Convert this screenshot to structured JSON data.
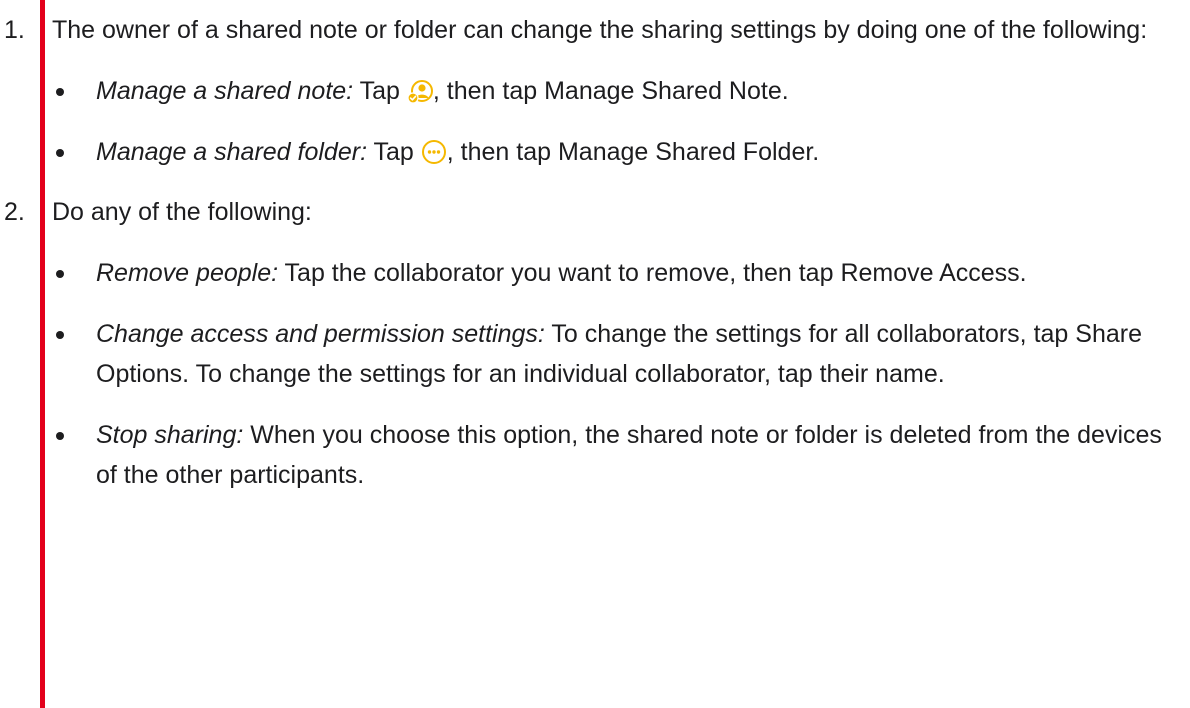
{
  "steps": [
    {
      "number": "1.",
      "text": "The owner of a shared note or folder can change the sharing settings by doing one of the following:",
      "bullets": [
        {
          "term": "Manage a shared note:",
          "pre": " Tap ",
          "icon": "collaborate-person-icon",
          "post": ", then tap Manage Shared Note."
        },
        {
          "term": "Manage a shared folder:",
          "pre": " Tap ",
          "icon": "more-ellipsis-circle-icon",
          "post": ", then tap Manage Shared Folder."
        }
      ]
    },
    {
      "number": "2.",
      "text": "Do any of the following:",
      "bullets": [
        {
          "term": "Remove people:",
          "text": " Tap the collaborator you want to remove, then tap Remove Access."
        },
        {
          "term": "Change access and permission settings:",
          "text": " To change the settings for all collaborators, tap Share Options. To change the settings for an individual collaborator, tap their name."
        },
        {
          "term": "Stop sharing:",
          "text": " When you choose this option, the shared note or folder is deleted from the devices of the other participants."
        }
      ]
    }
  ],
  "colors": {
    "highlight_bar": "#e3001b",
    "icon_fill": "#f5b800",
    "text": "#1d1d1f"
  }
}
